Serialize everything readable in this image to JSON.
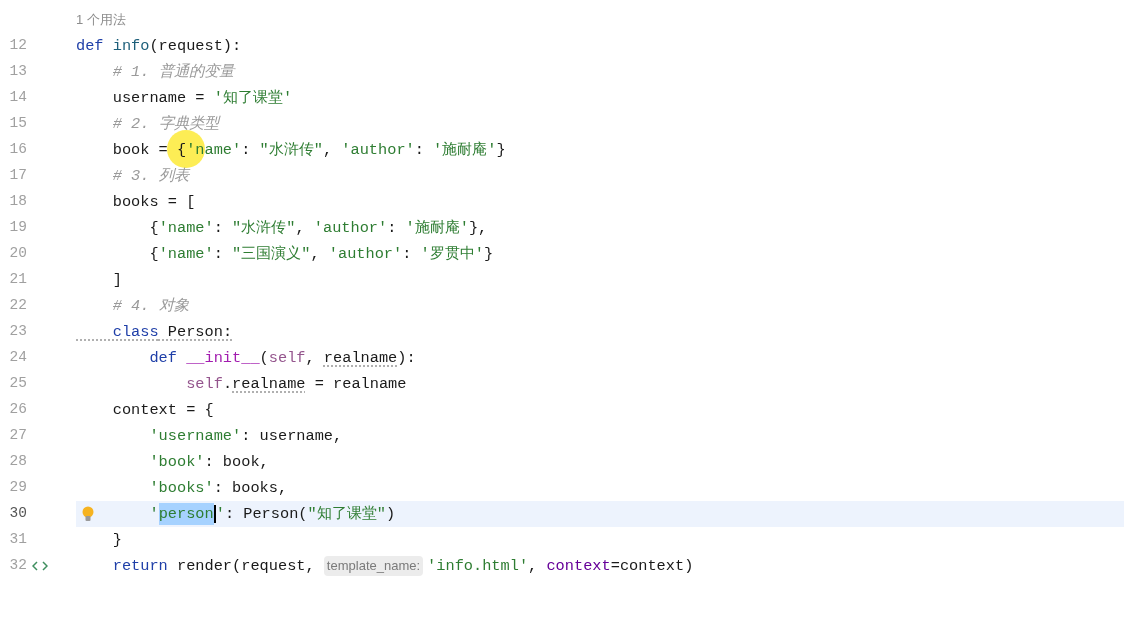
{
  "usage_hint": "1 个用法",
  "lines": [
    {
      "number": "12",
      "active": false,
      "tokens": [
        {
          "kind": "kw",
          "text": "def "
        },
        {
          "kind": "fn",
          "text": "info"
        },
        {
          "kind": "plain",
          "text": "(request):"
        }
      ]
    },
    {
      "number": "13",
      "active": false,
      "tokens": [
        {
          "kind": "cmt",
          "text": "    # 1. 普通的变量"
        }
      ]
    },
    {
      "number": "14",
      "active": false,
      "tokens": [
        {
          "kind": "plain",
          "text": "    username = "
        },
        {
          "kind": "str",
          "text": "'知了课堂'"
        }
      ]
    },
    {
      "number": "15",
      "active": false,
      "tokens": [
        {
          "kind": "cmt",
          "text": "    # 2. 字典类型"
        }
      ]
    },
    {
      "number": "16",
      "active": false,
      "tokens": [
        {
          "kind": "plain",
          "text": "    book = {"
        },
        {
          "kind": "str",
          "text": "'name'"
        },
        {
          "kind": "plain",
          "text": ": "
        },
        {
          "kind": "str",
          "text": "\"水浒传\""
        },
        {
          "kind": "plain",
          "text": ", "
        },
        {
          "kind": "str",
          "text": "'author'"
        },
        {
          "kind": "plain",
          "text": ": "
        },
        {
          "kind": "str",
          "text": "'施耐庵'"
        },
        {
          "kind": "plain",
          "text": "}"
        }
      ]
    },
    {
      "number": "17",
      "active": false,
      "tokens": [
        {
          "kind": "cmt",
          "text": "    # 3. 列表"
        }
      ]
    },
    {
      "number": "18",
      "active": false,
      "tokens": [
        {
          "kind": "plain",
          "text": "    books = ["
        }
      ]
    },
    {
      "number": "19",
      "active": false,
      "tokens": [
        {
          "kind": "plain",
          "text": "        {"
        },
        {
          "kind": "str",
          "text": "'name'"
        },
        {
          "kind": "plain",
          "text": ": "
        },
        {
          "kind": "str",
          "text": "\"水浒传\""
        },
        {
          "kind": "plain",
          "text": ", "
        },
        {
          "kind": "str",
          "text": "'author'"
        },
        {
          "kind": "plain",
          "text": ": "
        },
        {
          "kind": "str",
          "text": "'施耐庵'"
        },
        {
          "kind": "plain",
          "text": "},"
        }
      ]
    },
    {
      "number": "20",
      "active": false,
      "tokens": [
        {
          "kind": "plain",
          "text": "        {"
        },
        {
          "kind": "str",
          "text": "'name'"
        },
        {
          "kind": "plain",
          "text": ": "
        },
        {
          "kind": "str",
          "text": "\"三国演义\""
        },
        {
          "kind": "plain",
          "text": ", "
        },
        {
          "kind": "str",
          "text": "'author'"
        },
        {
          "kind": "plain",
          "text": ": "
        },
        {
          "kind": "str",
          "text": "'罗贯中'"
        },
        {
          "kind": "plain",
          "text": "}"
        }
      ]
    },
    {
      "number": "21",
      "active": false,
      "tokens": [
        {
          "kind": "plain",
          "text": "    ]"
        }
      ]
    },
    {
      "number": "22",
      "active": false,
      "tokens": [
        {
          "kind": "cmt",
          "text": "    # 4. 对象"
        }
      ]
    },
    {
      "number": "23",
      "active": false,
      "tokens": [
        {
          "kind": "kw",
          "text": "    class",
          "underline": true
        },
        {
          "kind": "plain",
          "text": " Person:",
          "underline": true
        }
      ]
    },
    {
      "number": "24",
      "active": false,
      "tokens": [
        {
          "kind": "kw",
          "text": "        def "
        },
        {
          "kind": "magic",
          "text": "__init__"
        },
        {
          "kind": "plain",
          "text": "("
        },
        {
          "kind": "self",
          "text": "self"
        },
        {
          "kind": "plain",
          "text": ", "
        },
        {
          "kind": "plain",
          "text": "realname",
          "underline": true
        },
        {
          "kind": "plain",
          "text": "):"
        }
      ]
    },
    {
      "number": "25",
      "active": false,
      "tokens": [
        {
          "kind": "self",
          "text": "            self"
        },
        {
          "kind": "plain",
          "text": "."
        },
        {
          "kind": "plain",
          "text": "realname",
          "underline": true
        },
        {
          "kind": "plain",
          "text": " = realname"
        }
      ]
    },
    {
      "number": "26",
      "active": false,
      "tokens": [
        {
          "kind": "plain",
          "text": "    context = {"
        }
      ]
    },
    {
      "number": "27",
      "active": false,
      "tokens": [
        {
          "kind": "str",
          "text": "        'username'"
        },
        {
          "kind": "plain",
          "text": ": username,"
        }
      ]
    },
    {
      "number": "28",
      "active": false,
      "tokens": [
        {
          "kind": "str",
          "text": "        'book'"
        },
        {
          "kind": "plain",
          "text": ": book,"
        }
      ]
    },
    {
      "number": "29",
      "active": false,
      "tokens": [
        {
          "kind": "str",
          "text": "        'books'"
        },
        {
          "kind": "plain",
          "text": ": books,"
        }
      ]
    },
    {
      "number": "30",
      "active": true,
      "bulb": true,
      "tokens": [
        {
          "kind": "str",
          "text": "        '"
        },
        {
          "kind": "sel",
          "text": "person"
        },
        {
          "kind": "caret"
        },
        {
          "kind": "str",
          "text": "'"
        },
        {
          "kind": "plain",
          "text": ": Person("
        },
        {
          "kind": "str",
          "text": "\"知了课堂\""
        },
        {
          "kind": "plain",
          "text": ")"
        }
      ]
    },
    {
      "number": "31",
      "active": false,
      "tokens": [
        {
          "kind": "plain",
          "text": "    }"
        }
      ]
    },
    {
      "number": "32",
      "active": false,
      "code_marker": true,
      "tokens": [
        {
          "kind": "kw",
          "text": "    return"
        },
        {
          "kind": "plain",
          "text": " render(request, "
        },
        {
          "kind": "hint",
          "text": "template_name:"
        },
        {
          "kind": "str",
          "text": "'info.html'"
        },
        {
          "kind": "plain",
          "text": ", "
        },
        {
          "kind": "named",
          "text": "context"
        },
        {
          "kind": "plain",
          "text": "=context)"
        }
      ]
    }
  ]
}
